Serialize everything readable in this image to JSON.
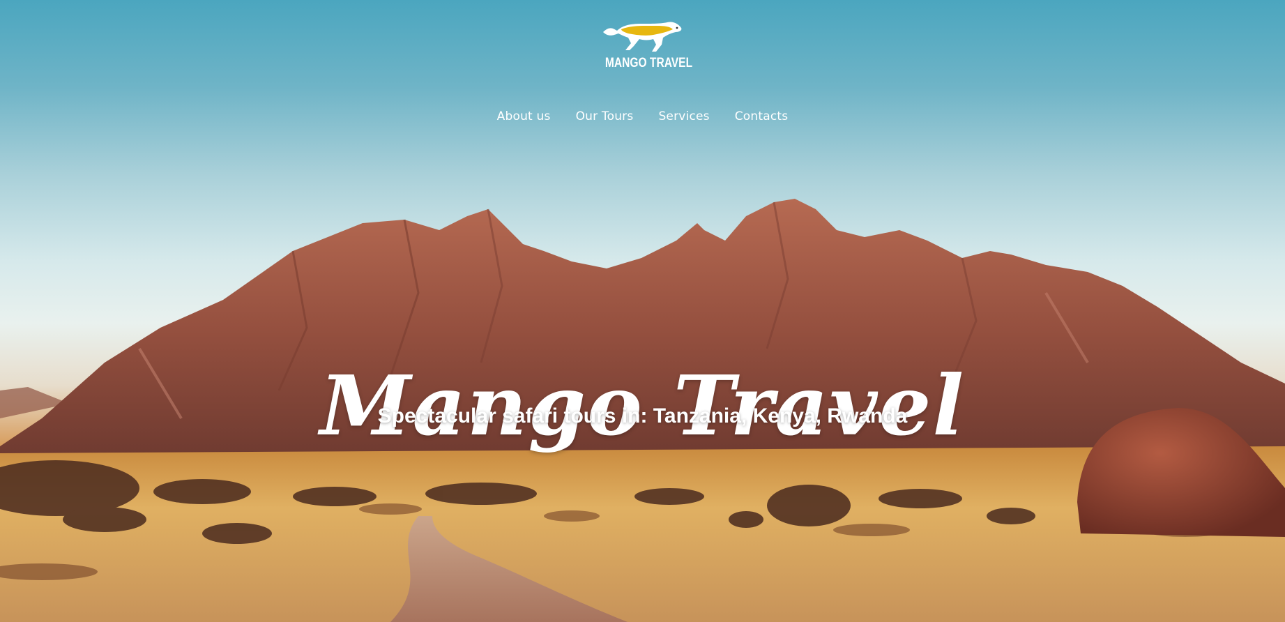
{
  "brand": {
    "logo_icon": "cheetah-icon",
    "name": "MANGO TRAVEL",
    "accent_color": "#e7b70f"
  },
  "nav": {
    "items": [
      {
        "label": "About us"
      },
      {
        "label": "Our Tours"
      },
      {
        "label": "Services"
      },
      {
        "label": "Contacts"
      }
    ]
  },
  "hero": {
    "title": "Mango Travel",
    "subtitle": "Spectacular safari tours in: Tanzania, Kenya, Rwanda"
  }
}
